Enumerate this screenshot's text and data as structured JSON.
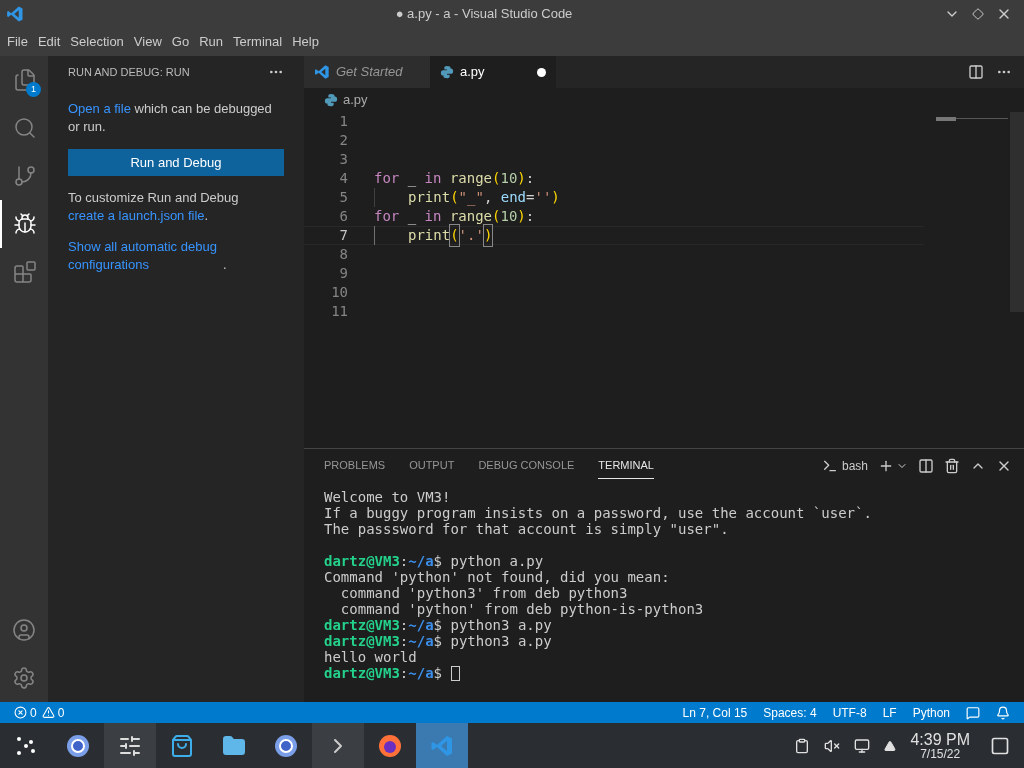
{
  "window": {
    "title": "● a.py - a - Visual Studio Code"
  },
  "menu": [
    "File",
    "Edit",
    "Selection",
    "View",
    "Go",
    "Run",
    "Terminal",
    "Help"
  ],
  "activity_bar": [
    {
      "kind": "files",
      "selected": false,
      "badge": "1"
    },
    {
      "kind": "search",
      "selected": false
    },
    {
      "kind": "source-control",
      "selected": false
    },
    {
      "kind": "run-debug",
      "selected": true
    },
    {
      "kind": "extensions",
      "selected": false
    }
  ],
  "activity_bottom": [
    {
      "kind": "account"
    },
    {
      "kind": "settings"
    }
  ],
  "sidebar": {
    "title": "RUN AND DEBUG: RUN",
    "intro": {
      "link": "Open a file",
      "text": " which can be debugged or run."
    },
    "button": "Run and Debug",
    "customize": {
      "text": "To customize Run and Debug",
      "link": "create a launch.json file",
      "tail": "."
    },
    "show_all": {
      "link": "Show all automatic debug configurations",
      "tail": "."
    }
  },
  "editor_tabs": [
    {
      "label": "Get Started",
      "kind": "welcome",
      "selected": false,
      "preview": true,
      "dirty": false
    },
    {
      "label": "a.py",
      "kind": "python",
      "selected": true,
      "preview": false,
      "dirty": true
    }
  ],
  "breadcrumb": "a.py",
  "code_lines": [
    {
      "number": "1",
      "current": false,
      "indented": false
    },
    {
      "number": "2",
      "current": false,
      "indented": false
    },
    {
      "number": "3",
      "current": false,
      "indented": false
    },
    {
      "number": "4",
      "current": false,
      "indented": false,
      "tokens": [
        {
          "kind": "keyword",
          "text": "for"
        },
        {
          "kind": "plain",
          "text": " _ "
        },
        {
          "kind": "keyword",
          "text": "in "
        },
        {
          "kind": "function",
          "text": "range"
        },
        {
          "kind": "paren",
          "text": "("
        },
        {
          "kind": "number",
          "text": "10"
        },
        {
          "kind": "paren",
          "text": ")"
        },
        {
          "kind": "plain",
          "text": ":"
        }
      ]
    },
    {
      "number": "5",
      "current": false,
      "indented": true,
      "tokens": [
        {
          "kind": "function",
          "text": "print"
        },
        {
          "kind": "paren",
          "text": "("
        },
        {
          "kind": "string",
          "text": "\"_\""
        },
        {
          "kind": "plain",
          "text": ", "
        },
        {
          "kind": "param",
          "text": "end"
        },
        {
          "kind": "plain",
          "text": "="
        },
        {
          "kind": "string",
          "text": "''"
        },
        {
          "kind": "paren",
          "text": ")"
        }
      ]
    },
    {
      "number": "6",
      "current": false,
      "indented": false,
      "tokens": [
        {
          "kind": "keyword",
          "text": "for"
        },
        {
          "kind": "plain",
          "text": " _ "
        },
        {
          "kind": "keyword",
          "text": "in "
        },
        {
          "kind": "function",
          "text": "range"
        },
        {
          "kind": "paren",
          "text": "("
        },
        {
          "kind": "number",
          "text": "10"
        },
        {
          "kind": "paren",
          "text": ")"
        },
        {
          "kind": "plain",
          "text": ":"
        }
      ]
    },
    {
      "number": "7",
      "current": true,
      "indented": true,
      "tokens": [
        {
          "kind": "function",
          "text": "print"
        },
        {
          "kind": "matched-paren",
          "text": "("
        },
        {
          "kind": "string",
          "text": "'.'"
        },
        {
          "kind": "matched-paren",
          "text": ")"
        }
      ]
    },
    {
      "number": "8",
      "current": false,
      "indented": false
    },
    {
      "number": "9",
      "current": false,
      "indented": false
    },
    {
      "number": "10",
      "current": false,
      "indented": false
    },
    {
      "number": "11",
      "current": false,
      "indented": false
    }
  ],
  "panel_tabs": [
    {
      "label": "PROBLEMS",
      "selected": false
    },
    {
      "label": "OUTPUT",
      "selected": false
    },
    {
      "label": "DEBUG CONSOLE",
      "selected": false
    },
    {
      "label": "TERMINAL",
      "selected": true
    }
  ],
  "terminal_name": "bash",
  "terminal_lines": [
    {
      "kind": "text",
      "segments": [
        {
          "kind": "out",
          "text": "Welcome to VM3!"
        }
      ]
    },
    {
      "kind": "text",
      "segments": [
        {
          "kind": "out",
          "text": "If a buggy program insists on a password, use the account `user`."
        }
      ]
    },
    {
      "kind": "text",
      "segments": [
        {
          "kind": "out",
          "text": "The passsword for that account is simply \"user\"."
        }
      ]
    },
    {
      "kind": "blank"
    },
    {
      "kind": "text",
      "segments": [
        {
          "kind": "user",
          "text": "dartz@VM3"
        },
        {
          "kind": "out",
          "text": ":"
        },
        {
          "kind": "path",
          "text": "~/a"
        },
        {
          "kind": "out",
          "text": "$ python a.py"
        }
      ]
    },
    {
      "kind": "text",
      "segments": [
        {
          "kind": "out",
          "text": "Command 'python' not found, did you mean:"
        }
      ]
    },
    {
      "kind": "text",
      "segments": [
        {
          "kind": "out",
          "text": "  command 'python3' from deb python3"
        }
      ]
    },
    {
      "kind": "text",
      "segments": [
        {
          "kind": "out",
          "text": "  command 'python' from deb python-is-python3"
        }
      ]
    },
    {
      "kind": "text",
      "segments": [
        {
          "kind": "user",
          "text": "dartz@VM3"
        },
        {
          "kind": "out",
          "text": ":"
        },
        {
          "kind": "path",
          "text": "~/a"
        },
        {
          "kind": "out",
          "text": "$ python3 a.py"
        }
      ]
    },
    {
      "kind": "text",
      "segments": [
        {
          "kind": "user",
          "text": "dartz@VM3"
        },
        {
          "kind": "out",
          "text": ":"
        },
        {
          "kind": "path",
          "text": "~/a"
        },
        {
          "kind": "out",
          "text": "$ python3 a.py"
        }
      ]
    },
    {
      "kind": "text",
      "segments": [
        {
          "kind": "out",
          "text": "hello world"
        }
      ]
    },
    {
      "kind": "text",
      "cursor": true,
      "segments": [
        {
          "kind": "user",
          "text": "dartz@VM3"
        },
        {
          "kind": "out",
          "text": ":"
        },
        {
          "kind": "path",
          "text": "~/a"
        },
        {
          "kind": "out",
          "text": "$"
        }
      ]
    }
  ],
  "status_bar": {
    "errors": "0",
    "warnings": "0",
    "items": [
      "Ln 7, Col 15",
      "Spaces: 4",
      "UTF-8",
      "LF",
      "Python"
    ]
  },
  "taskbar": {
    "apps": [
      {
        "kind": "launcher",
        "selected": false,
        "running": false
      },
      {
        "kind": "browser",
        "selected": false,
        "running": false
      },
      {
        "kind": "system-settings",
        "selected": false,
        "running": true
      },
      {
        "kind": "store",
        "selected": false,
        "running": false
      },
      {
        "kind": "files",
        "selected": false,
        "running": false
      },
      {
        "kind": "browser",
        "selected": false,
        "running": false
      },
      {
        "kind": "terminal",
        "selected": false,
        "running": true
      },
      {
        "kind": "firefox",
        "selected": false,
        "running": false
      },
      {
        "kind": "vscode",
        "selected": true,
        "running": true
      }
    ],
    "time": "4:39 PM",
    "date": "7/15/22"
  }
}
